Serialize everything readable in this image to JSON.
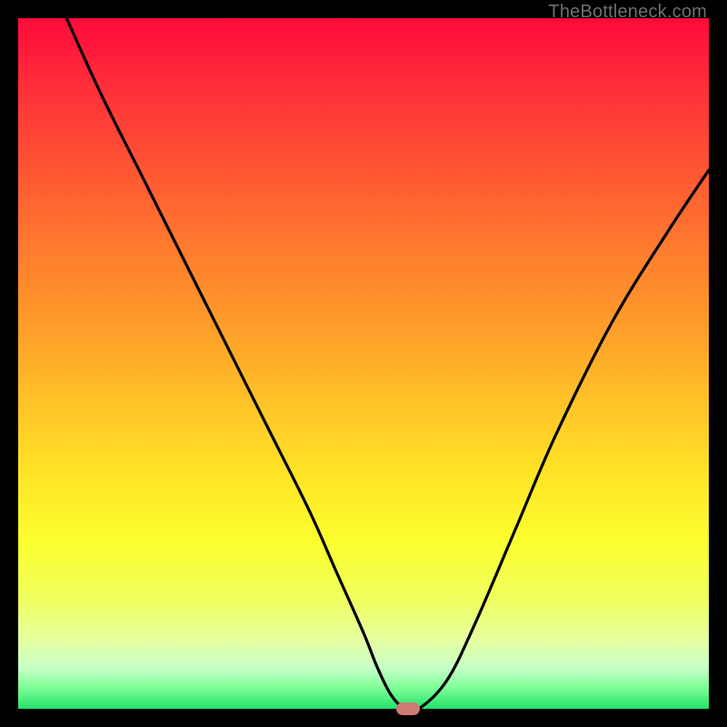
{
  "watermark": "TheBottleneck.com",
  "colors": {
    "frame": "#000000",
    "curve": "#000000",
    "marker": "#cf7a73"
  },
  "chart_data": {
    "type": "line",
    "title": "",
    "xlabel": "",
    "ylabel": "",
    "xlim": [
      0,
      100
    ],
    "ylim": [
      0,
      100
    ],
    "grid": false,
    "series": [
      {
        "name": "bottleneck-curve",
        "x": [
          7,
          12,
          18,
          24,
          30,
          36,
          42,
          46,
          50,
          52,
          54,
          56,
          58,
          62,
          66,
          72,
          78,
          86,
          94,
          100
        ],
        "y": [
          100,
          89,
          77,
          65,
          53,
          41,
          29,
          20,
          11,
          6,
          2,
          0,
          0,
          4,
          12,
          26,
          40,
          56,
          69,
          78
        ]
      }
    ],
    "marker": {
      "x": 56.5,
      "y": 0
    },
    "background_gradient": {
      "orientation": "vertical",
      "stops": [
        {
          "pos": 0.0,
          "color": "#ff0a3b"
        },
        {
          "pos": 0.22,
          "color": "#ff5633"
        },
        {
          "pos": 0.44,
          "color": "#ff9b2a"
        },
        {
          "pos": 0.66,
          "color": "#ffe426"
        },
        {
          "pos": 0.84,
          "color": "#f0ff5e"
        },
        {
          "pos": 0.94,
          "color": "#c8ffc8"
        },
        {
          "pos": 1.0,
          "color": "#21e06a"
        }
      ]
    }
  }
}
